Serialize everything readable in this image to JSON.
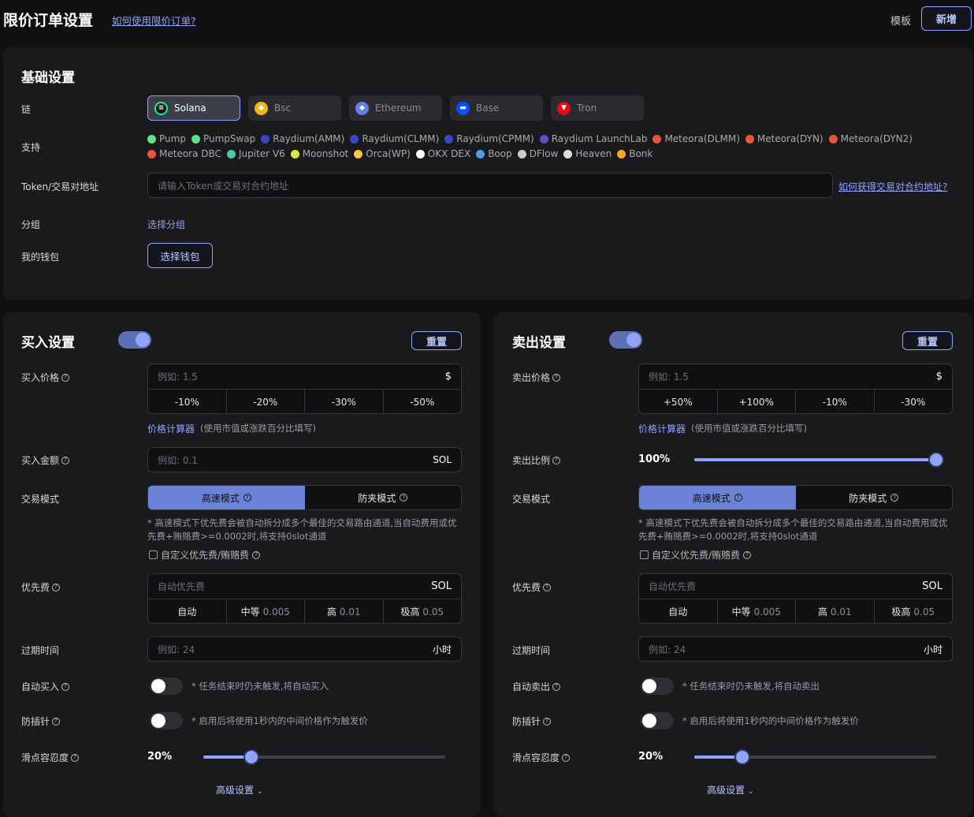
{
  "header": {
    "title": "限价订单设置",
    "help_link": "如何使用限价订单?",
    "template_label": "模板",
    "new_button": "新增"
  },
  "basic": {
    "title": "基础设置",
    "chain_label": "链",
    "chains": [
      {
        "name": "Solana",
        "color": "#111111",
        "icon": "solana-icon"
      },
      {
        "name": "Bsc",
        "color": "#f0b90b",
        "icon": "bsc-icon"
      },
      {
        "name": "Ethereum",
        "color": "#627eea",
        "icon": "ethereum-icon"
      },
      {
        "name": "Base",
        "color": "#0052ff",
        "icon": "base-icon"
      },
      {
        "name": "Tron",
        "color": "#e50914",
        "icon": "tron-icon"
      }
    ],
    "support_label": "支持",
    "platforms_row1": [
      {
        "name": "Pump",
        "color": "#5ee28d"
      },
      {
        "name": "PumpSwap",
        "color": "#5ee28d"
      },
      {
        "name": "Raydium(AMM)",
        "color": "#3a46c9"
      },
      {
        "name": "Raydium(CLMM)",
        "color": "#3a46c9"
      },
      {
        "name": "Raydium(CPMM)",
        "color": "#3a46c9"
      },
      {
        "name": "Raydium LaunchLab",
        "color": "#6a48c9"
      },
      {
        "name": "Meteora(DLMM)",
        "color": "#e8563c"
      },
      {
        "name": "Meteora(DYN)",
        "color": "#e8563c"
      },
      {
        "name": "Meteora(DYN2)",
        "color": "#e8563c"
      }
    ],
    "platforms_row2": [
      {
        "name": "Meteora DBC",
        "color": "#e8563c"
      },
      {
        "name": "Jupiter V6",
        "color": "#4fc6a5"
      },
      {
        "name": "Moonshot",
        "color": "#d8e83c"
      },
      {
        "name": "Orca(WP)",
        "color": "#f6c343"
      },
      {
        "name": "OKX DEX",
        "color": "#ffffff"
      },
      {
        "name": "Boop",
        "color": "#4b9be8"
      },
      {
        "name": "DFlow",
        "color": "#cccccc"
      },
      {
        "name": "Heaven",
        "color": "#dddddd"
      },
      {
        "name": "Bonk",
        "color": "#f6a623"
      }
    ],
    "token_label": "Token/交易对地址",
    "token_placeholder": "请输入Token或交易对合约地址",
    "token_help": "如何获得交易对合约地址?",
    "group_label": "分组",
    "group_link": "选择分组",
    "wallet_label": "我的钱包",
    "wallet_button": "选择钱包"
  },
  "buy": {
    "title": "买入设置",
    "enabled": true,
    "reset": "重置",
    "price_label": "买入价格",
    "price_placeholder": "例如: 1.5",
    "price_unit": "$",
    "price_opts": [
      "-10%",
      "-20%",
      "-30%",
      "-50%"
    ],
    "calc_link": "价格计算器",
    "calc_note": "(使用市值或涨跌百分比填写)",
    "amount_label": "买入金额",
    "amount_placeholder": "例如: 0.1",
    "amount_unit": "SOL",
    "mode_label": "交易模式",
    "mode_fast": "高速模式",
    "mode_mev": "防夹模式",
    "mode_note": "* 高速模式下优先费会被自动拆分成多个最佳的交易路由通道,当自动费用或优先费+贿赂费>=0.0002时,将支持0slot通道",
    "custom_fee": "自定义优先费/贿赂费",
    "fee_label": "优先费",
    "fee_placeholder": "自动优先费",
    "fee_unit": "SOL",
    "fee_opts": [
      {
        "label": "自动",
        "sub": ""
      },
      {
        "label": "中等",
        "sub": "0.005"
      },
      {
        "label": "高",
        "sub": "0.01"
      },
      {
        "label": "极高",
        "sub": "0.05"
      }
    ],
    "expire_label": "过期时间",
    "expire_placeholder": "例如: 24",
    "expire_unit": "小时",
    "auto_label": "自动买入",
    "auto_note": "* 任务结束时仍未触发,将自动买入",
    "anti_label": "防插针",
    "anti_note": "* 启用后将使用1秒内的中间价格作为触发价",
    "slip_label": "滑点容忍度",
    "slip_value": "20%",
    "slip_fraction": 0.2,
    "advanced": "高级设置"
  },
  "sell": {
    "title": "卖出设置",
    "enabled": true,
    "reset": "重置",
    "price_label": "卖出价格",
    "price_placeholder": "例如: 1.5",
    "price_unit": "$",
    "price_opts": [
      "+50%",
      "+100%",
      "-10%",
      "-30%"
    ],
    "calc_link": "价格计算器",
    "calc_note": "(使用市值或涨跌百分比填写)",
    "ratio_label": "卖出比例",
    "ratio_value": "100%",
    "ratio_fraction": 1.0,
    "mode_label": "交易模式",
    "mode_fast": "高速模式",
    "mode_mev": "防夹模式",
    "mode_note": "* 高速模式下优先费会被自动拆分成多个最佳的交易路由通道,当自动费用或优先费+贿赂费>=0.0002时,将支持0slot通道",
    "custom_fee": "自定义优先费/贿赂费",
    "fee_label": "优先费",
    "fee_placeholder": "自动优先费",
    "fee_unit": "SOL",
    "fee_opts": [
      {
        "label": "自动",
        "sub": ""
      },
      {
        "label": "中等",
        "sub": "0.005"
      },
      {
        "label": "高",
        "sub": "0.01"
      },
      {
        "label": "极高",
        "sub": "0.05"
      }
    ],
    "expire_label": "过期时间",
    "expire_placeholder": "例如: 24",
    "expire_unit": "小时",
    "auto_label": "自动卖出",
    "auto_note": "* 任务结束时仍未触发,将自动卖出",
    "anti_label": "防插针",
    "anti_note": "* 启用后将使用1秒内的中间价格作为触发价",
    "slip_label": "滑点容忍度",
    "slip_value": "20%",
    "slip_fraction": 0.2,
    "advanced": "高级设置"
  }
}
